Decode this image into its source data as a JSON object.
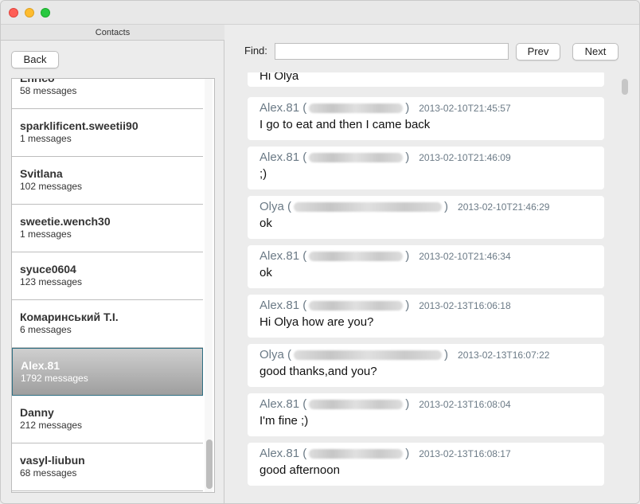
{
  "window": {
    "colors": {
      "close": "#fe5f57",
      "minimize": "#febc2e",
      "maximize": "#28c840"
    }
  },
  "contacts": {
    "header": "Contacts",
    "back_label": "Back",
    "items": [
      {
        "name": "Enrico",
        "count": "58 messages"
      },
      {
        "name": "sparklificent.sweetii90",
        "count": "1 messages"
      },
      {
        "name": "Svitlana",
        "count": "102 messages"
      },
      {
        "name": "sweetie.wench30",
        "count": "1 messages"
      },
      {
        "name": "syuce0604",
        "count": "123 messages"
      },
      {
        "name": "Комаринський Т.І.",
        "count": "6 messages"
      },
      {
        "name": "Alex.81",
        "count": "1792 messages",
        "selected": true
      },
      {
        "name": "Danny",
        "count": "212 messages"
      },
      {
        "name": "vasyl-liubun",
        "count": "68 messages"
      }
    ]
  },
  "find": {
    "label": "Find:",
    "value": "",
    "prev_label": "Prev",
    "next_label": "Next"
  },
  "messages": [
    {
      "sender": "",
      "time": "",
      "text": "Hi Olya",
      "partial": true
    },
    {
      "sender": "Alex.81",
      "time": "2013-02-10T21:45:57",
      "text": "I go to eat and then I came back"
    },
    {
      "sender": "Alex.81",
      "time": "2013-02-10T21:46:09",
      "text": ";)"
    },
    {
      "sender": "Olya",
      "time": "2013-02-10T21:46:29",
      "text": "ok"
    },
    {
      "sender": "Alex.81",
      "time": "2013-02-10T21:46:34",
      "text": "ok"
    },
    {
      "sender": "Alex.81",
      "time": "2013-02-13T16:06:18",
      "text": "Hi Olya how are you?"
    },
    {
      "sender": "Olya",
      "time": "2013-02-13T16:07:22",
      "text": "good thanks,and you?"
    },
    {
      "sender": "Alex.81",
      "time": "2013-02-13T16:08:04",
      "text": "I'm fine ;)"
    },
    {
      "sender": "Alex.81",
      "time": "2013-02-13T16:08:17",
      "text": "good afternoon"
    }
  ]
}
